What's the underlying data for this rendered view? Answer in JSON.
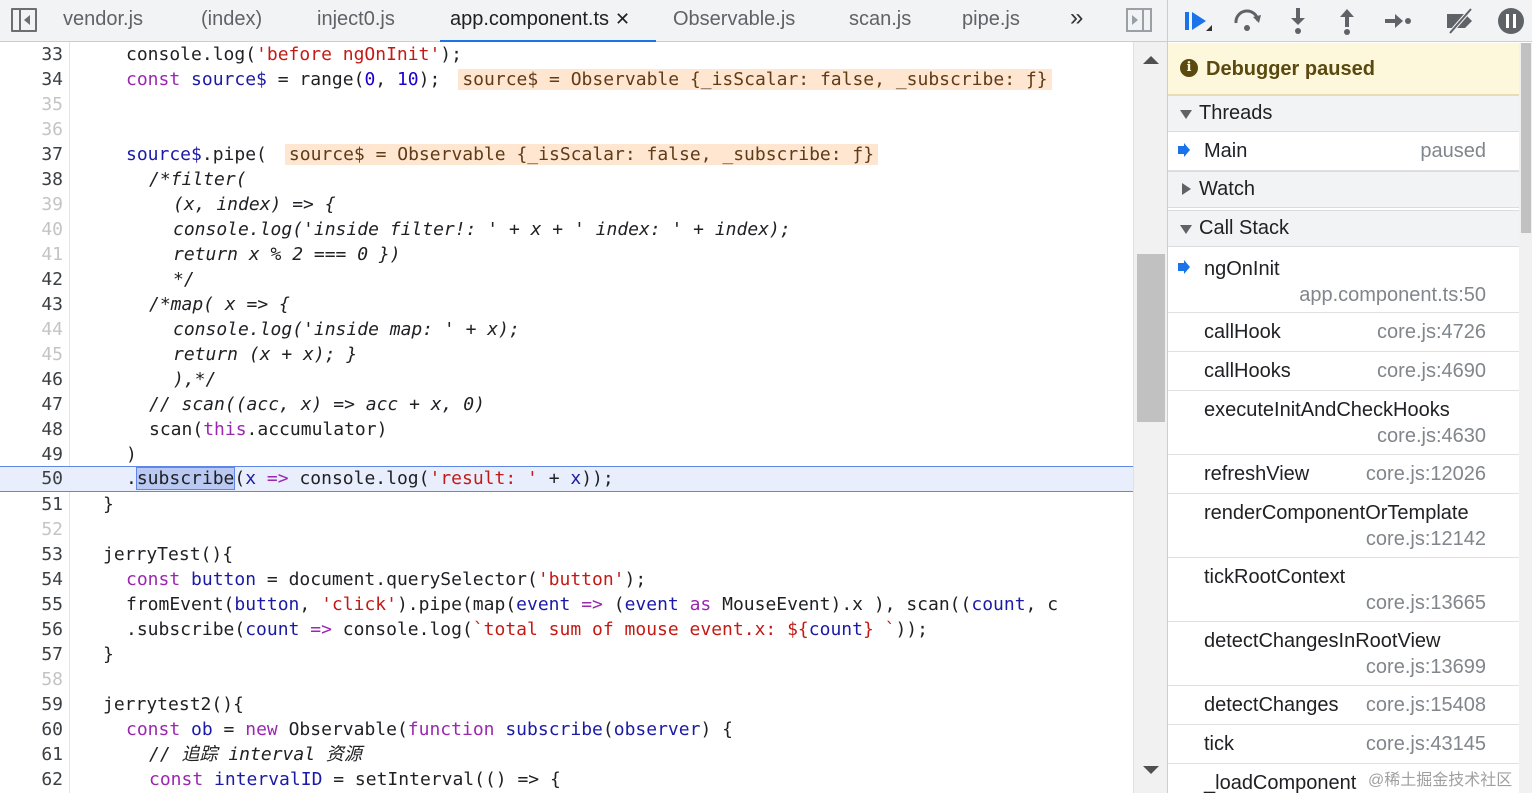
{
  "tabs": [
    {
      "label": "vendor.js",
      "active": false
    },
    {
      "label": "(index)",
      "active": false
    },
    {
      "label": "inject0.js",
      "active": false
    },
    {
      "label": "app.component.ts",
      "active": true
    },
    {
      "label": "Observable.js",
      "active": false
    },
    {
      "label": "scan.js",
      "active": false
    },
    {
      "label": "pipe.js",
      "active": false
    }
  ],
  "tab_close_glyph": "✕",
  "tab_overflow_glyph": "»",
  "editor": {
    "execution_line": 50,
    "lines": [
      {
        "n": "33",
        "faint": false
      },
      {
        "n": "34",
        "faint": false
      },
      {
        "n": "35",
        "faint": true
      },
      {
        "n": "36",
        "faint": true
      },
      {
        "n": "37",
        "faint": false
      },
      {
        "n": "38",
        "faint": false
      },
      {
        "n": "39",
        "faint": true
      },
      {
        "n": "40",
        "faint": true
      },
      {
        "n": "41",
        "faint": true
      },
      {
        "n": "42",
        "faint": false
      },
      {
        "n": "43",
        "faint": false
      },
      {
        "n": "44",
        "faint": true
      },
      {
        "n": "45",
        "faint": true
      },
      {
        "n": "46",
        "faint": false
      },
      {
        "n": "47",
        "faint": false
      },
      {
        "n": "48",
        "faint": false
      },
      {
        "n": "49",
        "faint": false
      },
      {
        "n": "50",
        "faint": false
      },
      {
        "n": "51",
        "faint": false
      },
      {
        "n": "52",
        "faint": true
      },
      {
        "n": "53",
        "faint": false
      },
      {
        "n": "54",
        "faint": false
      },
      {
        "n": "55",
        "faint": false
      },
      {
        "n": "56",
        "faint": false
      },
      {
        "n": "57",
        "faint": false
      },
      {
        "n": "58",
        "faint": true
      },
      {
        "n": "59",
        "faint": false
      },
      {
        "n": "60",
        "faint": false
      },
      {
        "n": "61",
        "faint": false
      },
      {
        "n": "62",
        "faint": false
      }
    ],
    "code": {
      "l33_a": "console.log(",
      "l33_b": "'before ngOnInit'",
      "l33_c": ");",
      "l34_kw": "const",
      "l34_var": "source$",
      "l34_b": " = range(",
      "l34_n1": "0",
      "l34_c": ", ",
      "l34_n2": "10",
      "l34_d": ");",
      "l34_inline": "source$ = Observable {_isScalar: false, _subscribe: ƒ}",
      "l37_var": "source$",
      "l37_b": ".pipe(",
      "l37_inline": "source$ = Observable {_isScalar: false, _subscribe: ƒ}",
      "l38": "/*filter(",
      "l39": "(x, index) => {",
      "l40": "console.log('inside filter!: ' + x + ' index: ' + index);",
      "l41": "return x % 2 === 0 })",
      "l42": "*/",
      "l43": "/*map( x => {",
      "l44": "console.log('inside map: ' + x);",
      "l45": "return (x + x); }",
      "l46": "),*/",
      "l47": "// scan((acc, x) => acc + x, 0)",
      "l48_a": "scan(",
      "l48_kw": "this",
      "l48_b": ".accumulator)",
      "l49": ")",
      "l50_a": ".",
      "l50_sel": "subscribe",
      "l50_b": "(",
      "l50_x": "x",
      "l50_arrow": " => ",
      "l50_c": "console.log(",
      "l50_str": "'result: '",
      "l50_d": " + ",
      "l50_x2": "x",
      "l50_e": "));",
      "l51": "}",
      "l53": "jerryTest(){",
      "l54_kw": "const",
      "l54_var": "button",
      "l54_b": " = document.querySelector(",
      "l54_str": "'button'",
      "l54_c": ");",
      "l55_a": "fromEvent(",
      "l55_var": "button",
      "l55_b": ", ",
      "l55_str": "'click'",
      "l55_c": ").pipe(map(",
      "l55_var2": "event",
      "l55_arrow": " => ",
      "l55_d": "(",
      "l55_var3": "event",
      "l55_as": " as ",
      "l55_e": "MouseEvent).x ), scan((",
      "l55_var4": "count",
      "l55_f": ", c",
      "l56_a": ".subscribe(",
      "l56_var": "count",
      "l56_arrow": " => ",
      "l56_b": "console.log(",
      "l56_str": "`total sum of mouse event.x: ${",
      "l56_var2": "count",
      "l56_str2": "} `",
      "l56_c": "));",
      "l57": "}",
      "l59": "jerrytest2(){",
      "l60_kw": "const",
      "l60_var": "ob",
      "l60_b": " = ",
      "l60_new": "new",
      "l60_c": " Observable(",
      "l60_fn": "function",
      "l60_d": " ",
      "l60_name": "subscribe",
      "l60_e": "(",
      "l60_var2": "observer",
      "l60_f": ") {",
      "l61": "// 追踪 interval 资源",
      "l62_kw": "const",
      "l62_var": "intervalID",
      "l62_b": " = setInterval(() => {"
    }
  },
  "debugger": {
    "banner": "Debugger paused",
    "banner_icon": "info-icon",
    "threads_label": "Threads",
    "thread_name": "Main",
    "thread_status": "paused",
    "watch_label": "Watch",
    "callstack_label": "Call Stack",
    "frames": [
      {
        "name": "ngOnInit",
        "loc": "app.component.ts:50",
        "current": true,
        "wrap": true
      },
      {
        "name": "callHook",
        "loc": "core.js:4726",
        "current": false,
        "wrap": false
      },
      {
        "name": "callHooks",
        "loc": "core.js:4690",
        "current": false,
        "wrap": false
      },
      {
        "name": "executeInitAndCheckHooks",
        "loc": "core.js:4630",
        "current": false,
        "wrap": true
      },
      {
        "name": "refreshView",
        "loc": "core.js:12026",
        "current": false,
        "wrap": false
      },
      {
        "name": "renderComponentOrTemplate",
        "loc": "core.js:12142",
        "current": false,
        "wrap": true
      },
      {
        "name": "tickRootContext",
        "loc": "core.js:13665",
        "current": false,
        "wrap": true
      },
      {
        "name": "detectChangesInRootView",
        "loc": "core.js:13699",
        "current": false,
        "wrap": true
      },
      {
        "name": "detectChanges",
        "loc": "core.js:15408",
        "current": false,
        "wrap": false
      },
      {
        "name": "tick",
        "loc": "core.js:43145",
        "current": false,
        "wrap": false
      },
      {
        "name": "_loadComponent",
        "loc": "",
        "current": false,
        "wrap": false
      }
    ],
    "colors": {
      "accent": "#1a73e8",
      "banner_bg": "#fdf7dc",
      "exec_line": "#e8eefc"
    }
  },
  "watermark": "@稀土掘金技术社区"
}
